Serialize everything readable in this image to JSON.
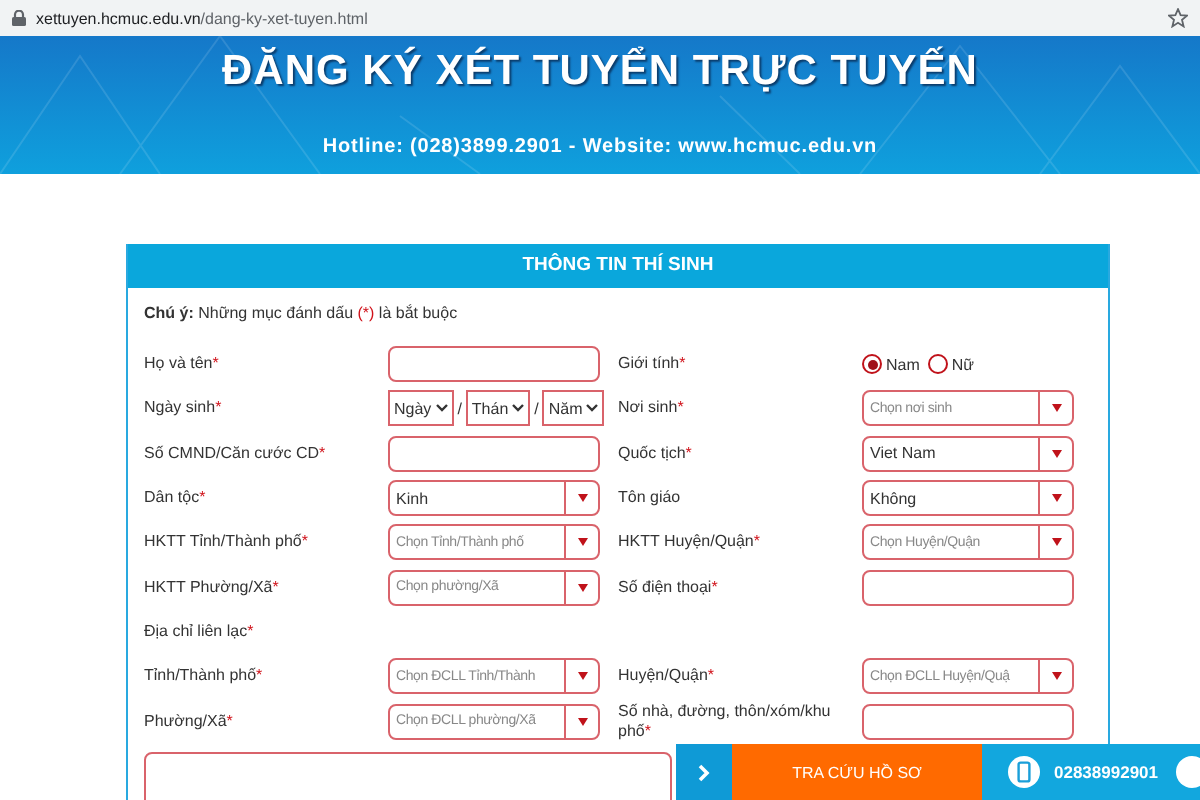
{
  "address_bar": {
    "host": "xettuyen.hcmuc.edu.vn",
    "path": "/dang-ky-xet-tuyen.html"
  },
  "banner": {
    "title": "ĐĂNG KÝ XÉT TUYỂN TRỰC TUYẾN",
    "subtitle": "Hotline: (028)3899.2901 - Website: www.hcmuc.edu.vn"
  },
  "form": {
    "title": "THÔNG TIN THÍ SINH",
    "required_mark": "*",
    "note": {
      "label": "Chú ý:",
      "text": "Những mục đánh dấu",
      "mark": "(*)",
      "text_after": "là bắt buộc"
    },
    "rows": [
      {
        "left": {
          "label": "Họ và tên",
          "required": true,
          "kind": "text"
        },
        "right": {
          "label": "Giới tính",
          "required": true,
          "kind": "radio",
          "options": [
            {
              "label": "Nam",
              "selected": true
            },
            {
              "label": "Nữ",
              "selected": false
            }
          ]
        }
      },
      {
        "left": {
          "label": "Ngày sinh",
          "required": true,
          "kind": "date",
          "parts": [
            "Ngày",
            "Thán",
            "Năm"
          ],
          "separator": "/"
        },
        "right": {
          "label": "Nơi sinh",
          "required": true,
          "kind": "select",
          "placeholder": "Chọn nơi sinh"
        }
      },
      {
        "left": {
          "label": "Số CMND/Căn cước CD",
          "required": true,
          "kind": "text"
        },
        "right": {
          "label": "Quốc tịch",
          "required": true,
          "kind": "select",
          "value": "Viet Nam"
        }
      },
      {
        "left": {
          "label": "Dân tộc",
          "required": true,
          "kind": "select",
          "value": "Kinh"
        },
        "right": {
          "label": "Tôn giáo",
          "required": false,
          "kind": "select",
          "value": "Không"
        }
      },
      {
        "left": {
          "label": "HKTT Tỉnh/Thành phố",
          "required": true,
          "kind": "select",
          "placeholder": "Chọn Tỉnh/Thành phố"
        },
        "right": {
          "label": "HKTT Huyện/Quận",
          "required": true,
          "kind": "select",
          "placeholder": "Chọn Huyện/Quận"
        }
      },
      {
        "left": {
          "label": "HKTT Phường/Xã",
          "required": true,
          "kind": "select",
          "placeholder": "Chọn phường/Xã"
        },
        "right": {
          "label": "Số điện thoại",
          "required": true,
          "kind": "text"
        }
      },
      {
        "left": {
          "label": "Địa chỉ liên lạc",
          "required": true,
          "kind": "heading"
        }
      },
      {
        "left": {
          "label": "Tỉnh/Thành phố",
          "required": true,
          "kind": "select",
          "placeholder": "Chọn ĐCLL Tỉnh/Thành"
        },
        "right": {
          "label": "Huyện/Quận",
          "required": true,
          "kind": "select",
          "placeholder": "Chọn ĐCLL Huyện/Quậ"
        }
      },
      {
        "left": {
          "label": "Phường/Xã",
          "required": true,
          "kind": "select",
          "placeholder": "Chọn ĐCLL phường/Xã"
        },
        "right": {
          "label": "Số nhà, đường, thôn/xóm/khu phố",
          "required": true,
          "kind": "text"
        }
      }
    ],
    "bottom_field": {
      "kind": "textarea"
    }
  },
  "bottom_bar": {
    "lookup": "TRA CỨU HỒ SƠ",
    "phone": "02838992901"
  }
}
